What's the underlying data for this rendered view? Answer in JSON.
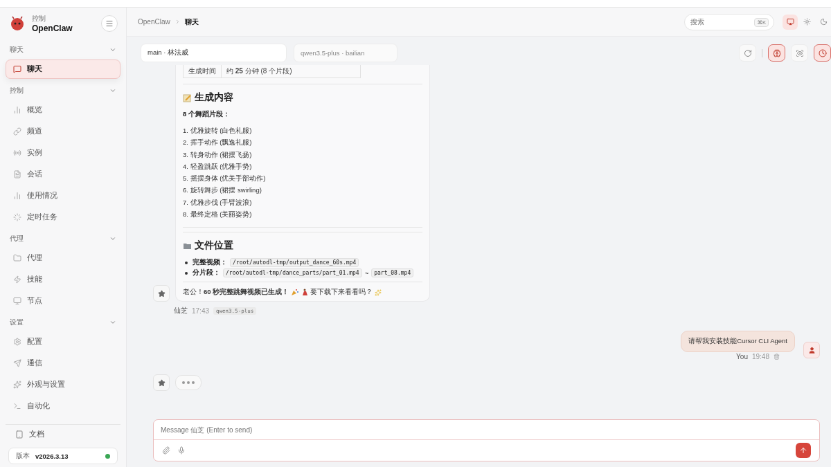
{
  "sidebar": {
    "brand": {
      "caption": "控制",
      "title": "OpenClaw"
    },
    "groups": [
      {
        "label": "聊天",
        "expanded": true,
        "items": [
          {
            "label": "聊天",
            "selected": true
          }
        ]
      },
      {
        "label": "控制",
        "expanded": true,
        "items": [
          {
            "label": "概览",
            "selected": false
          },
          {
            "label": "频道",
            "selected": false
          },
          {
            "label": "实例",
            "selected": false
          },
          {
            "label": "会话",
            "selected": false
          },
          {
            "label": "使用情况",
            "selected": false
          },
          {
            "label": "定时任务",
            "selected": false
          }
        ]
      },
      {
        "label": "代理",
        "expanded": true,
        "items": [
          {
            "label": "代理",
            "selected": false
          },
          {
            "label": "技能",
            "selected": false
          },
          {
            "label": "节点",
            "selected": false
          }
        ]
      },
      {
        "label": "设置",
        "expanded": true,
        "items": [
          {
            "label": "配置",
            "selected": false
          },
          {
            "label": "通信",
            "selected": false
          },
          {
            "label": "外观与设置",
            "selected": false
          },
          {
            "label": "自动化",
            "selected": false
          }
        ]
      }
    ],
    "docs": "文档",
    "version": {
      "label": "版本",
      "value": "v2026.3.13",
      "online": true
    }
  },
  "header": {
    "breadcrumb": [
      "OpenClaw",
      "聊天"
    ],
    "search": {
      "placeholder": "搜索",
      "shortcut": "⌘K"
    },
    "theme_modes": [
      {
        "selected": true
      },
      {
        "selected": false
      },
      {
        "selected": false
      }
    ]
  },
  "toolbar": {
    "session": "main · 林法威",
    "model": "qwen3.5-plus · bailian",
    "actions": [
      {
        "active": false
      },
      {
        "active": true
      },
      {
        "active": false
      },
      {
        "active": true
      }
    ]
  },
  "messages": [
    {
      "kind": "assistant",
      "table": [
        {
          "label": "生成时间",
          "value": "约 **25** 分钟 (8 个片段)"
        }
      ],
      "sections": [
        {
          "kind": "list",
          "heading": "生成内容",
          "subheading": "8 个舞蹈片段：",
          "items": [
            "1. 优雅旋转 (白色礼服)",
            "2. 挥手动作 (飘逸礼服)",
            "3. 转身动作 (裙摆飞扬)",
            "4. 轻盈跳跃 (优雅手势)",
            "5. 摇摆身体 (优美手部动作)",
            "6. 旋转舞步 (裙摆 swirling)",
            "7. 优雅步伐 (手臂波浪)",
            "8. 最终定格 (美丽姿势)"
          ]
        },
        {
          "kind": "files",
          "heading": "文件位置",
          "files": [
            {
              "label": "完整视频：",
              "paths": [
                "/root/autodl-tmp/output_dance_60s.mp4"
              ]
            },
            {
              "label": "分片段：",
              "paths": [
                "/root/autodl-tmp/dance_parts/part_01.mp4",
                "part_08.mp4"
              ],
              "separator": "~"
            }
          ]
        }
      ],
      "closing": {
        "before": "老公！**60 秒完整跳舞视频已生成！**",
        "after": "要下载下来看看吗？"
      },
      "sender": "仙芝",
      "time": "17:43",
      "model": "qwen3.5-plus"
    },
    {
      "kind": "user",
      "text": "请帮我安装技能Cursor CLI Agent",
      "sender": "You",
      "time": "19:48"
    },
    {
      "kind": "typing"
    }
  ],
  "composer": {
    "placeholder": "Message 仙芝 (Enter to send)"
  }
}
